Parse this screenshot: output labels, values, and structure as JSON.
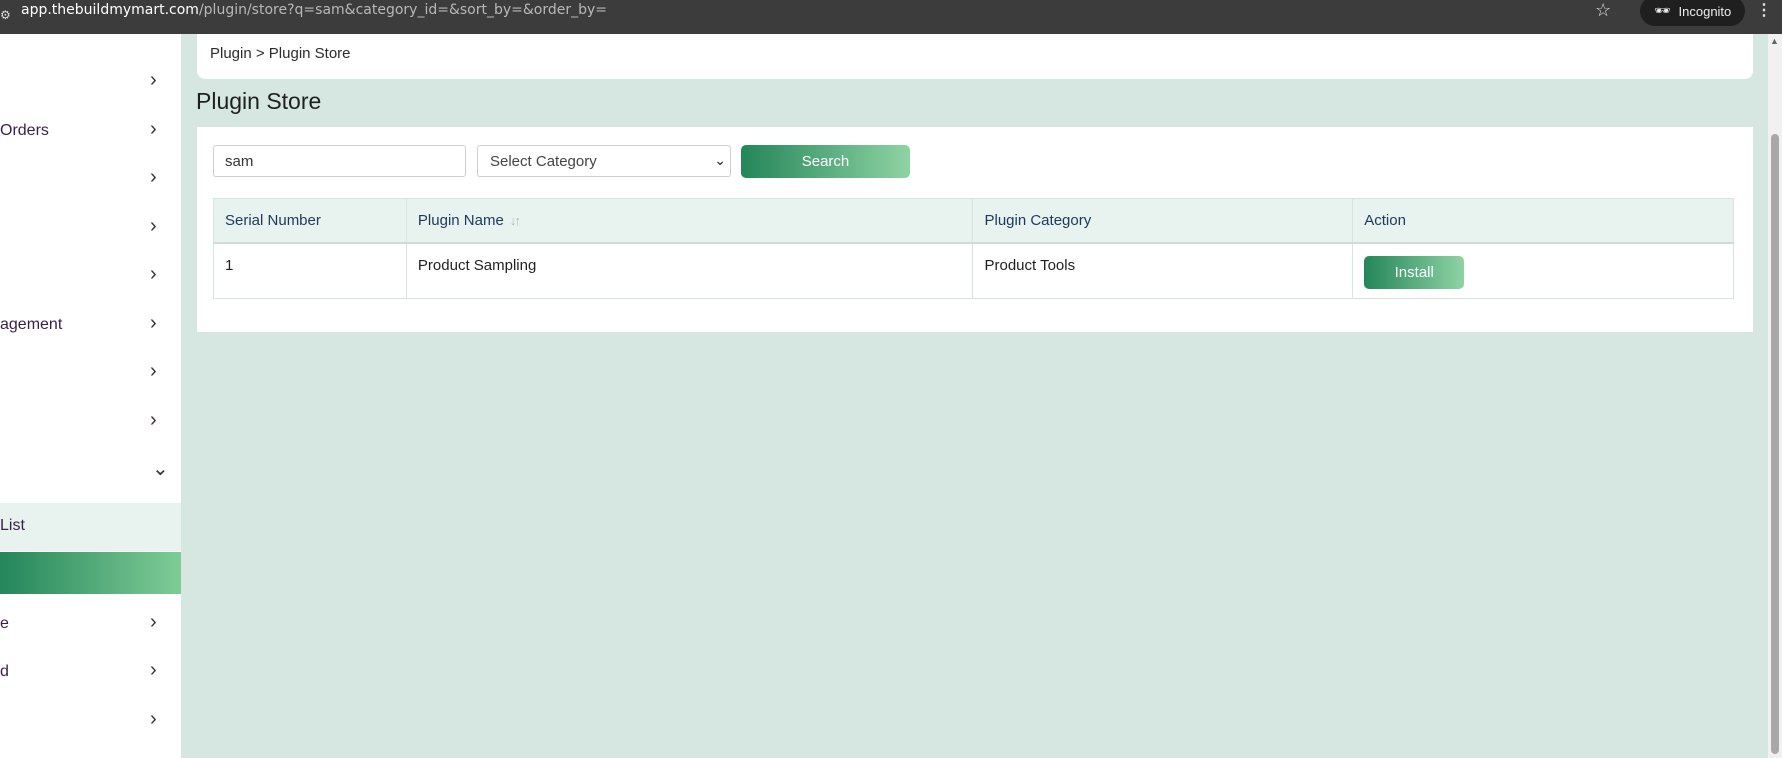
{
  "browser": {
    "url_host": "app.thebuildmymart.com",
    "url_path": "/plugin/store?q=sam&category_id=&sort_by=&order_by=",
    "incognito_label": "Incognito"
  },
  "sidebar": {
    "items": [
      {
        "label": "",
        "chevron": "›"
      },
      {
        "label": "Orders",
        "chevron": "›"
      },
      {
        "label": "",
        "chevron": "›"
      },
      {
        "label": "",
        "chevron": "›"
      },
      {
        "label": "",
        "chevron": "›"
      },
      {
        "label": "agement",
        "chevron": "›"
      },
      {
        "label": "",
        "chevron": "›"
      },
      {
        "label": "",
        "chevron": "›"
      },
      {
        "label": "",
        "chevron": "⌄"
      },
      {
        "label": "List",
        "chevron": ""
      },
      {
        "label": "",
        "chevron": ""
      },
      {
        "label": "e",
        "chevron": "›"
      },
      {
        "label": "d",
        "chevron": "›"
      },
      {
        "label": "",
        "chevron": "›"
      }
    ]
  },
  "breadcrumb": {
    "text": "Plugin > Plugin Store"
  },
  "page": {
    "title": "Plugin Store"
  },
  "search": {
    "value": "sam",
    "category_placeholder": "Select Category",
    "button_label": "Search"
  },
  "table": {
    "headers": {
      "serial": "Serial Number",
      "name": "Plugin Name",
      "category": "Plugin Category",
      "action": "Action"
    },
    "rows": [
      {
        "serial": "1",
        "name": "Product Sampling",
        "category": "Product Tools",
        "action_label": "Install"
      }
    ]
  },
  "colors": {
    "accent_start": "#24865a",
    "accent_end": "#8fd3a3",
    "page_bg": "#d6e7e2",
    "header_text": "#1d3a5e"
  }
}
